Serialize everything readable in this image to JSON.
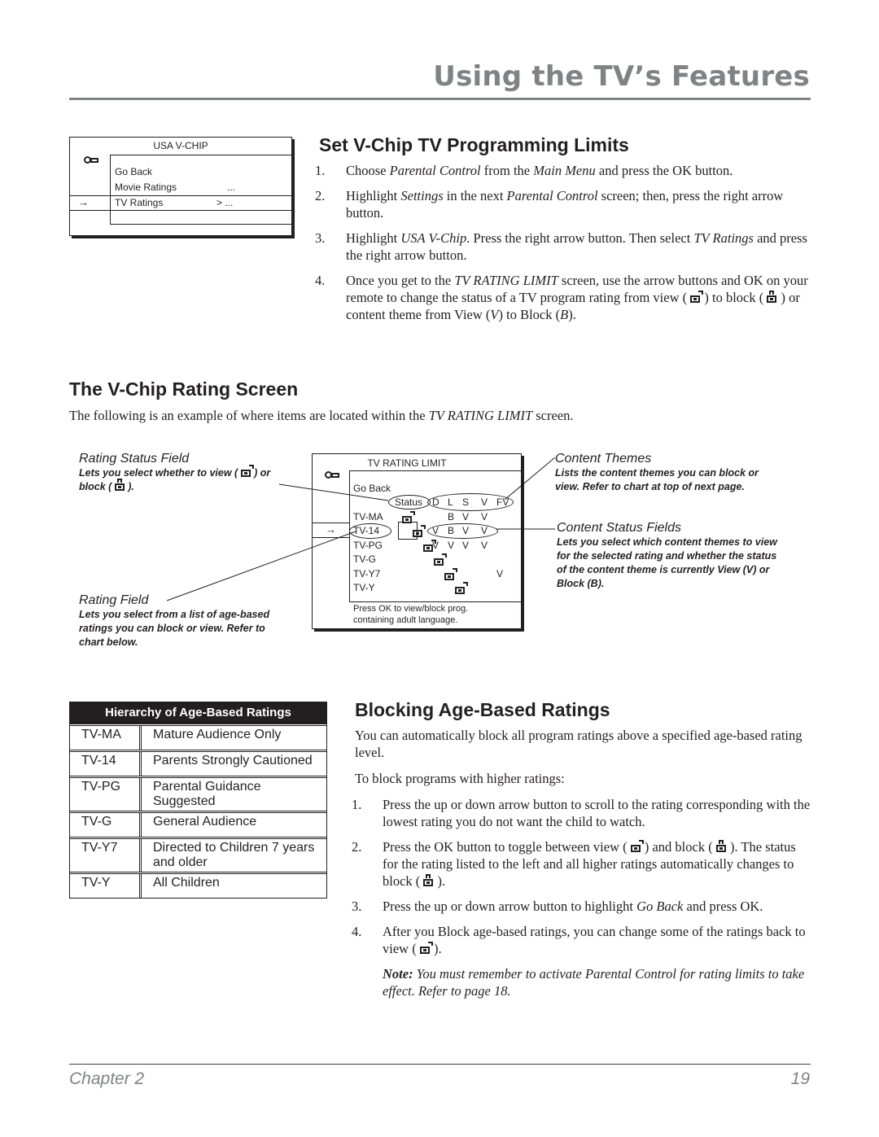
{
  "header": {
    "page_title": "Using the TV’s Features"
  },
  "usa_vchip_menu": {
    "title": "USA V-CHIP",
    "items": [
      {
        "label": "Go Back",
        "value": ""
      },
      {
        "label": "Movie Ratings",
        "value": "..."
      },
      {
        "label": "TV Ratings",
        "value": "> ...",
        "selected": true
      }
    ]
  },
  "set_limits": {
    "heading": "Set V-Chip TV Programming Limits",
    "steps": [
      {
        "num": "1.",
        "parts": [
          "Choose ",
          "Parental Control",
          " from the ",
          "Main Menu",
          " and press the OK button."
        ]
      },
      {
        "num": "2.",
        "parts": [
          "Highlight ",
          "Settings",
          " in the next ",
          "Parental Control",
          " screen; then, press the right arrow button."
        ]
      },
      {
        "num": "3.",
        "parts": [
          "Highlight ",
          "USA V-Chip",
          ". Press the right arrow button. Then select ",
          "TV Ratings",
          " and press the right arrow button."
        ]
      },
      {
        "num": "4.",
        "parts": [
          "Once you get to the ",
          "TV RATING LIMIT",
          " screen, use the arrow buttons and OK on your remote to change the status of a TV program rating from view ( ",
          "",
          " ) to block ( ",
          "",
          " ) or content theme from View (",
          "V",
          ") to Block (",
          "B",
          ")."
        ]
      }
    ]
  },
  "rating_screen": {
    "heading": "The V-Chip Rating Screen",
    "intro_before": "The following is an example of where items are located within the ",
    "intro_em": "TV RATING LIMIT",
    "intro_after": " screen."
  },
  "callouts": {
    "rating_status_field": {
      "title": "Rating Status Field",
      "text_a": "Lets you select whether to view ( ",
      "text_b": " ) or block ( ",
      "text_c": " )."
    },
    "rating_field": {
      "title": "Rating Field",
      "text": "Lets you select from a list of age-based ratings you can block or view. Refer to chart below."
    },
    "content_themes": {
      "title": "Content Themes",
      "text": "Lists the content themes you can block or view. Refer to chart at top of next page."
    },
    "content_status_fields": {
      "title": "Content Status Fields",
      "text": "Lets you select which content themes to view for the selected rating and whether the status of the content theme is currently View (V) or Block (B)."
    }
  },
  "tv_rating_limit": {
    "title": "TV RATING LIMIT",
    "go_back": "Go Back",
    "status_label": "Status",
    "themes": [
      "D",
      "L",
      "S",
      "V",
      "FV"
    ],
    "rows": [
      {
        "rating": "TV-MA",
        "status": "view",
        "themes": [
          "",
          "B",
          "V",
          "V",
          ""
        ]
      },
      {
        "rating": "TV-14",
        "status": "view",
        "selected": true,
        "themes": [
          "V",
          "B",
          "V",
          "V",
          ""
        ]
      },
      {
        "rating": "TV-PG",
        "status": "view",
        "themes": [
          "V",
          "V",
          "V",
          "V",
          ""
        ]
      },
      {
        "rating": "TV-G",
        "status": "view",
        "themes": [
          "",
          "",
          "",
          "",
          ""
        ]
      },
      {
        "rating": "TV-Y7",
        "status": "view",
        "themes": [
          "",
          "",
          "",
          "",
          "V"
        ]
      },
      {
        "rating": "TV-Y",
        "status": "view",
        "themes": [
          "",
          "",
          "",
          "",
          ""
        ]
      }
    ],
    "help_line1": "Press OK to view/block prog.",
    "help_line2": "containing adult language."
  },
  "hierarchy": {
    "title": "Hierarchy of Age-Based Ratings",
    "rows": [
      {
        "rating": "TV-MA",
        "description": "Mature Audience Only"
      },
      {
        "rating": "TV-14",
        "description": "Parents Strongly Cautioned"
      },
      {
        "rating": "TV-PG",
        "description": "Parental Guidance Suggested"
      },
      {
        "rating": "TV-G",
        "description": "General Audience"
      },
      {
        "rating": "TV-Y7",
        "description": "Directed to Children 7 years and older"
      },
      {
        "rating": "TV-Y",
        "description": "All Children"
      }
    ]
  },
  "blocking": {
    "heading": "Blocking Age-Based Ratings",
    "intro": "You can automatically block all program ratings above a specified age-based rating level.",
    "lead": "To block programs with higher ratings:",
    "step1": "Press the up or down arrow button to scroll to the rating corresponding with the lowest rating you do not want the child to watch.",
    "step2_a": "Press the OK button to toggle between view ( ",
    "step2_b": " ) and block ( ",
    "step2_c": " ). The status for the rating listed to the left and all higher ratings automatically changes to block ( ",
    "step2_d": " ).",
    "step3_a": "Press the up or down arrow button to highlight ",
    "step3_em": "Go Back",
    "step3_b": " and press OK.",
    "step4_a": "After you Block age-based ratings, you can change some of the ratings back to view ( ",
    "step4_b": " ).",
    "note_label": "Note:",
    "note_text": " You must remember to activate Parental Control for rating limits to take effect. Refer to page 18."
  },
  "footer": {
    "chapter": "Chapter 2",
    "page_number": "19"
  }
}
